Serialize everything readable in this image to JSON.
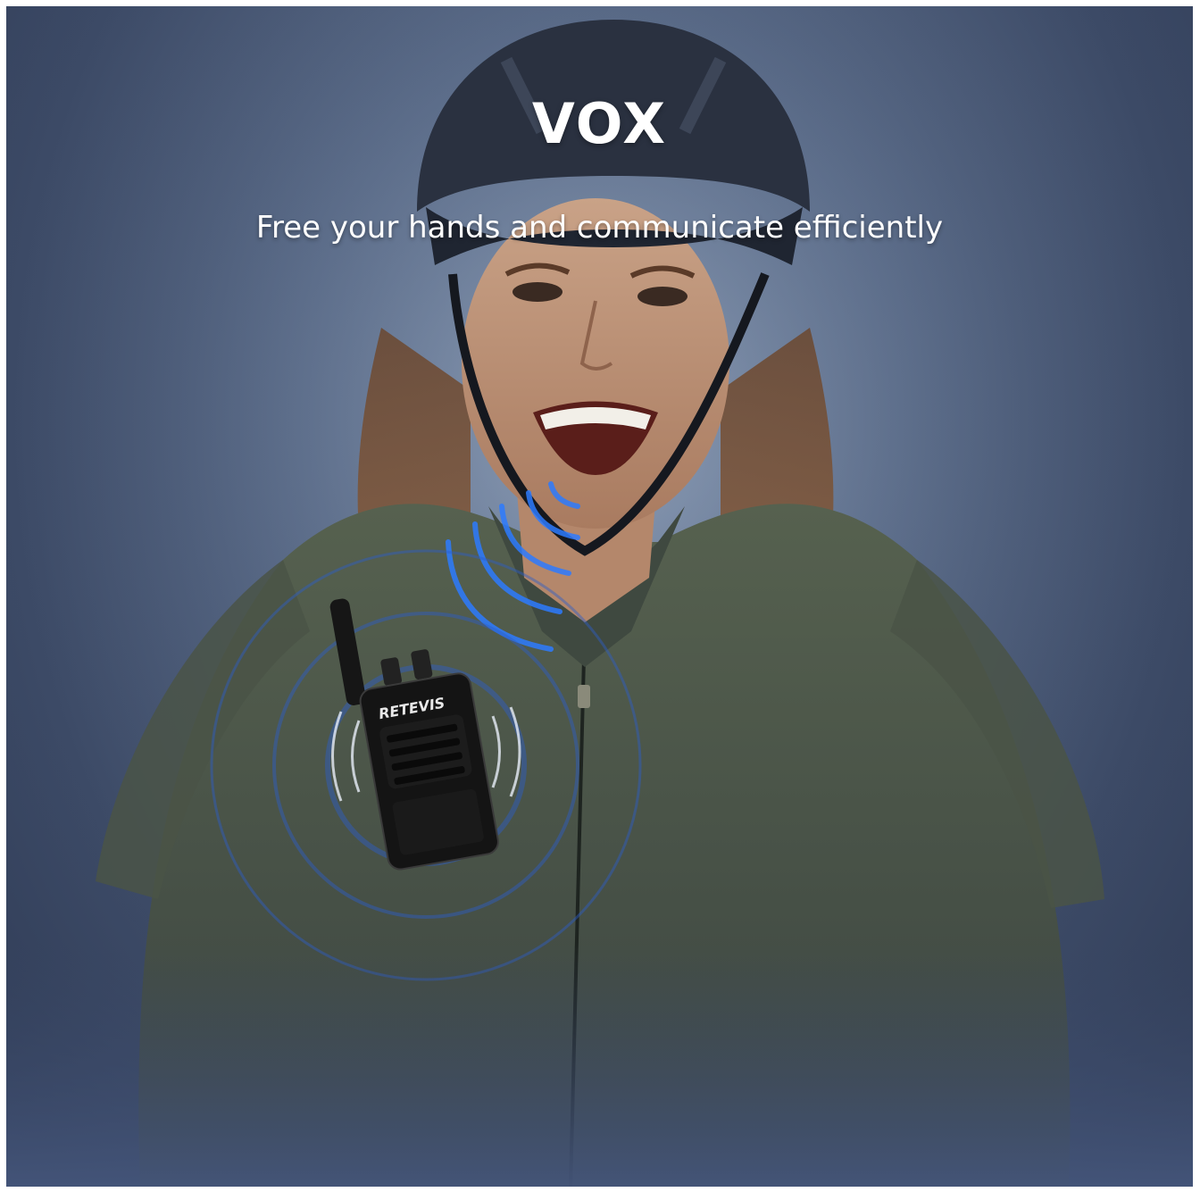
{
  "banner": {
    "title": "VOX",
    "subtitle": "Free your hands and communicate efficiently"
  },
  "product": {
    "brand": "RETEVIS"
  },
  "colors": {
    "background": "#4a5a78",
    "text": "#ffffff",
    "signal_wave": "#2d7bff",
    "jacket": "#4a5446",
    "helmet": "#2a3140",
    "radio_body": "#141414"
  },
  "icons": {
    "voice_signal": "sound-wave-icon"
  }
}
